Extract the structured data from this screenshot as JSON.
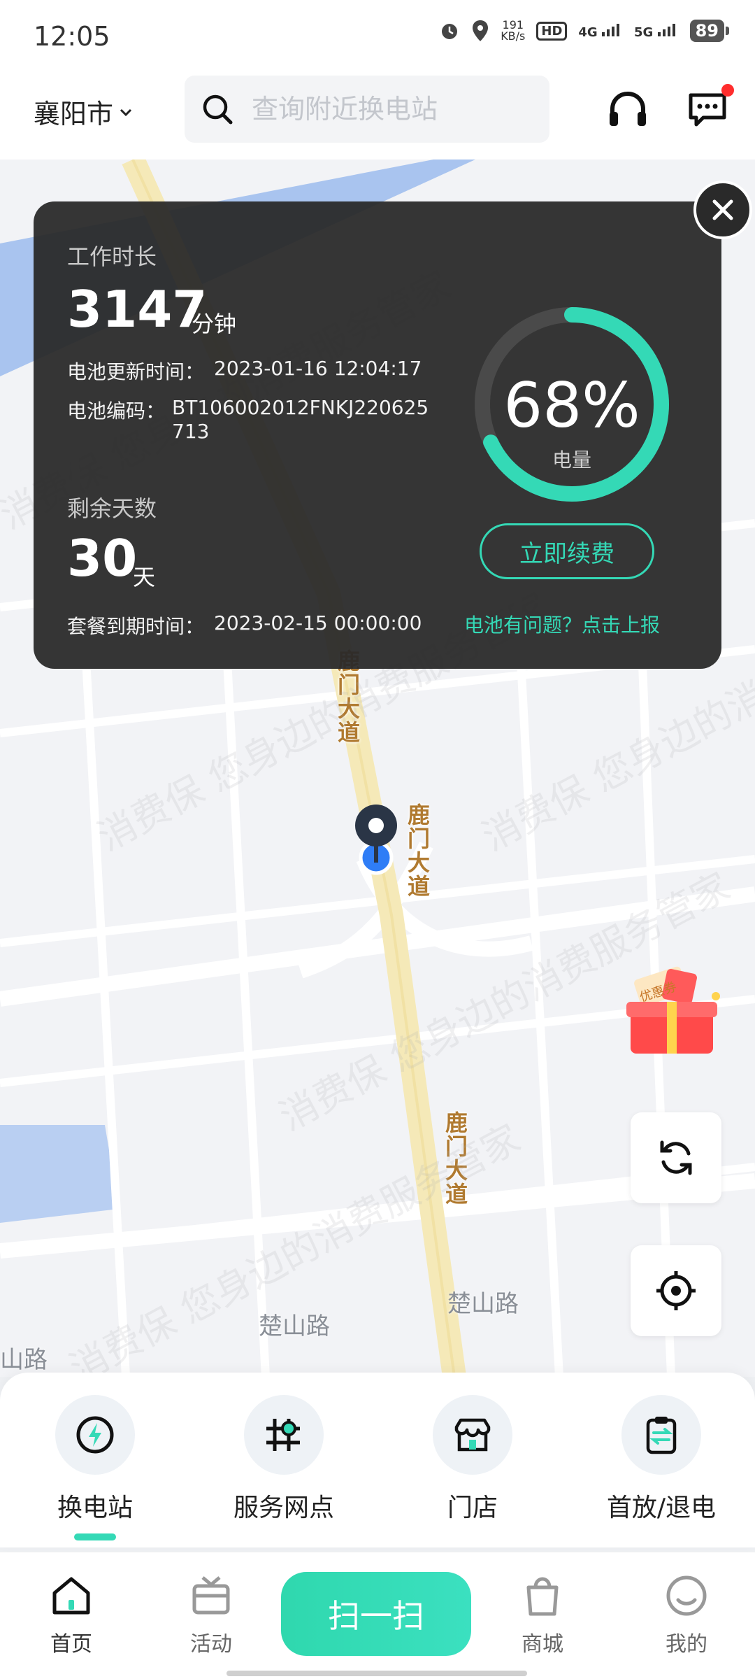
{
  "status_bar": {
    "time": "12:05",
    "net_speed_value": "191",
    "net_speed_unit": "KB/s",
    "hd_label": "HD",
    "net_4g": "4G",
    "net_5g": "5G",
    "battery": "89"
  },
  "header": {
    "city": "襄阳市",
    "search_placeholder": "查询附近换电站"
  },
  "map": {
    "road_lumen": "鹿门大道",
    "road_chushan": "楚山路",
    "road_chushan_left": "山路",
    "watermark": "消费保 您身边的消费服务管家"
  },
  "battery_card": {
    "work_duration_label": "工作时长",
    "work_duration_value": "3147",
    "work_duration_unit": "分钟",
    "update_time_label": "电池更新时间：",
    "update_time_value": "2023-01-16 12:04:17",
    "battery_code_label": "电池编码：",
    "battery_code_line1": "BT106002012FNKJ220625",
    "battery_code_line2": "713",
    "remaining_days_label": "剩余天数",
    "remaining_days_value": "30",
    "remaining_days_unit": "天",
    "expiry_label": "套餐到期时间：",
    "expiry_value": "2023-02-15 00:00:00",
    "charge_percent": 68,
    "charge_text": "68%",
    "charge_label": "电量",
    "renew_label": "立即续费",
    "report_link": "电池有问题？点击上报"
  },
  "gift_label": "优惠券",
  "services": [
    {
      "name": "换电站",
      "icon": "lightning-icon"
    },
    {
      "name": "服务网点",
      "icon": "service-point-icon"
    },
    {
      "name": "门店",
      "icon": "store-icon"
    },
    {
      "name": "首放/退电",
      "icon": "swap-clipboard-icon"
    }
  ],
  "bottom_nav": {
    "home": "首页",
    "activity": "活动",
    "scan": "扫一扫",
    "mall": "商城",
    "mine": "我的"
  },
  "colors": {
    "accent": "#34d9b6",
    "card_bg": "#282828",
    "notify_dot": "#ff2d2d"
  }
}
